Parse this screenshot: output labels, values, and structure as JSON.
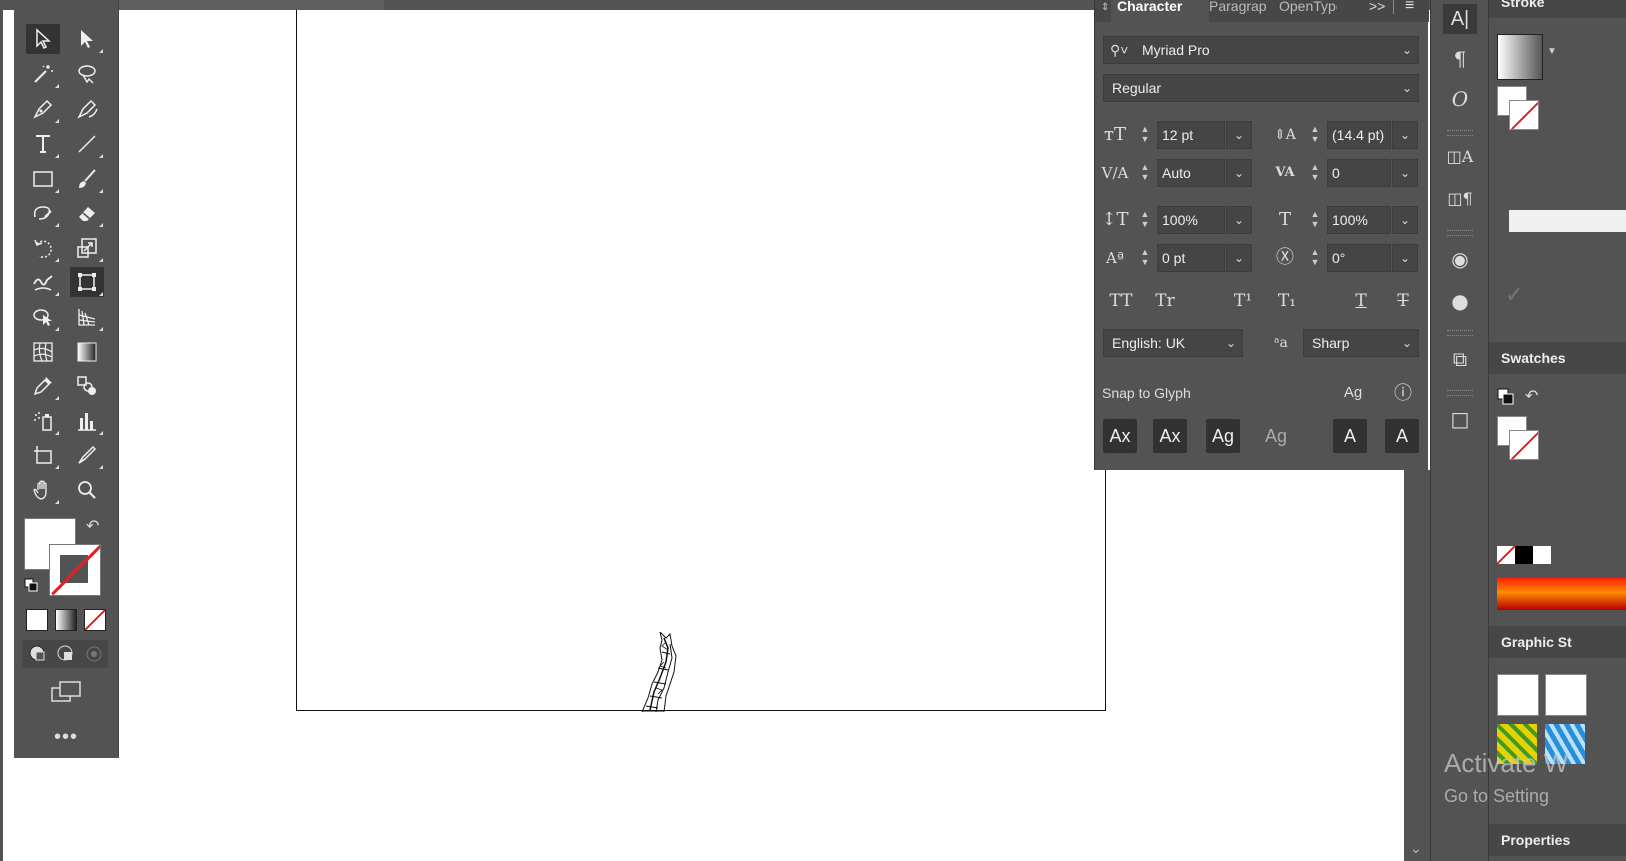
{
  "character_panel": {
    "tabs": [
      "Character",
      "Paragraph",
      "OpenType"
    ],
    "font_family": "Myriad Pro",
    "font_style": "Regular",
    "font_size": "12 pt",
    "leading": "(14.4 pt)",
    "kerning": "Auto",
    "tracking": "0",
    "vertical_scale": "100%",
    "horizontal_scale": "100%",
    "baseline_shift": "0 pt",
    "rotation": "0°",
    "language": "English: UK",
    "antialiasing": "Sharp",
    "snap_to_glyph_label": "Snap to Glyph",
    "type_buttons": [
      "TT",
      "Tr",
      "T¹",
      "T₁",
      "T",
      "T"
    ],
    "snap_buttons": [
      "Ax",
      "Ax",
      "Ag",
      "Ag",
      "A",
      "A"
    ]
  },
  "right_panels": {
    "stroke_title": "Stroke",
    "swatches_title": "Swatches",
    "graphic_styles_title": "Graphic St",
    "properties_title": "Properties"
  },
  "watermark": {
    "line1": "Activate W",
    "line2": "Go to Setting"
  },
  "colors": {
    "panel_bg": "#535353",
    "panel_dark": "#474747",
    "field_bg": "#454545",
    "none_red": "#e31e24"
  },
  "tool_icons": [
    "selection",
    "direct-selection",
    "magic-wand",
    "lasso",
    "pen",
    "curvature",
    "type",
    "line-segment",
    "rectangle",
    "paintbrush",
    "shaper",
    "eraser",
    "rotate",
    "scale",
    "warp",
    "free-transform",
    "shape-builder",
    "perspective-grid",
    "mesh",
    "gradient",
    "eyedropper",
    "blend",
    "symbol-sprayer",
    "column-graph",
    "artboard",
    "slice",
    "hand",
    "zoom"
  ]
}
